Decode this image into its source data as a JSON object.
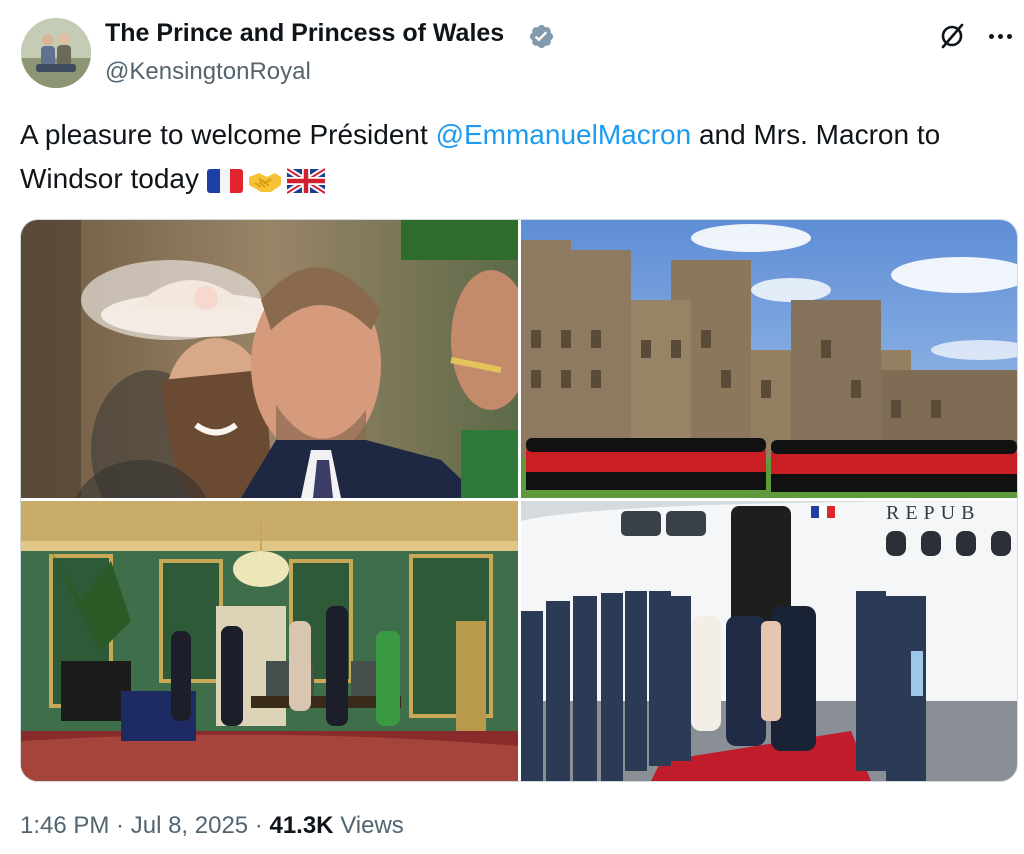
{
  "author": {
    "name": "The Prince and Princess of Wales",
    "handle": "@KensingtonRoyal",
    "verified": true,
    "verified_color": "#829aab"
  },
  "icons": [
    "grok-icon",
    "more-options-icon",
    "verified-badge-icon"
  ],
  "tweet": {
    "text_before": "A pleasure to welcome Président ",
    "mention": "@EmmanuelMacron",
    "text_after": " and Mrs. Macron to Windsor today ",
    "emojis": [
      "flag-france",
      "handshake",
      "flag-united-kingdom"
    ],
    "mention_color": "#1d9bf0"
  },
  "media": [
    {
      "depicts": "royal-couple-photo"
    },
    {
      "depicts": "windsor-castle-guards-photo"
    },
    {
      "depicts": "green-drawing-room-photo"
    },
    {
      "depicts": "airport-arrival-photo"
    },
    {
      "overlay_text": "REPUB"
    }
  ],
  "meta": {
    "time": "1:46 PM",
    "separator": " · ",
    "date": "Jul 8, 2025",
    "views_count": "41.3K",
    "views_label": "Views"
  }
}
